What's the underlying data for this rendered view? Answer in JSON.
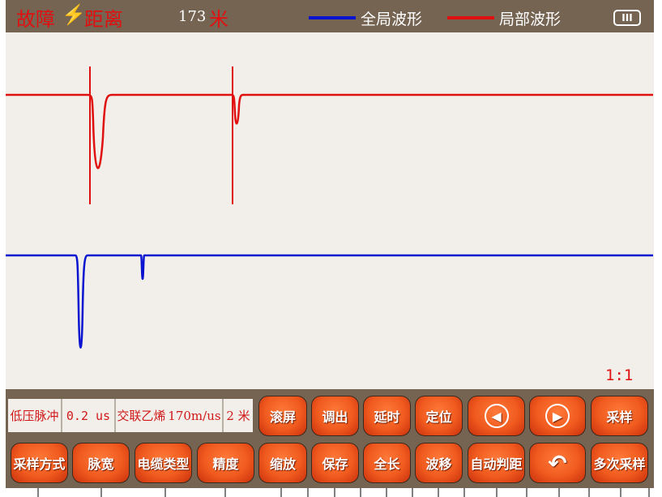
{
  "header": {
    "title": "故障",
    "title2": "距离",
    "distance": "173",
    "unit": "米",
    "legend_global": "全局波形",
    "legend_local": "局部波形",
    "battery_icon": "battery-full-icon"
  },
  "colors": {
    "global": "#0a14d0",
    "local": "#e01010"
  },
  "plot": {
    "scale": "1:1"
  },
  "info": {
    "mode": "低压脉冲",
    "pulse_width": "0.2 us",
    "cable": "交联乙烯",
    "velocity": "170m/us",
    "precision": "2 米"
  },
  "buttons": {
    "scroll": "滚屏",
    "recall": "调出",
    "delay": "延时",
    "locate": "定位",
    "sample": "采样",
    "sample_mode": "采样方式",
    "pulse": "脉宽",
    "cable_type": "电缆类型",
    "precision": "精度",
    "zoom": "缩放",
    "save": "保存",
    "full_length": "全长",
    "wave_shift": "波移",
    "auto_distance": "自动判距",
    "multi_sample": "多次采样"
  }
}
